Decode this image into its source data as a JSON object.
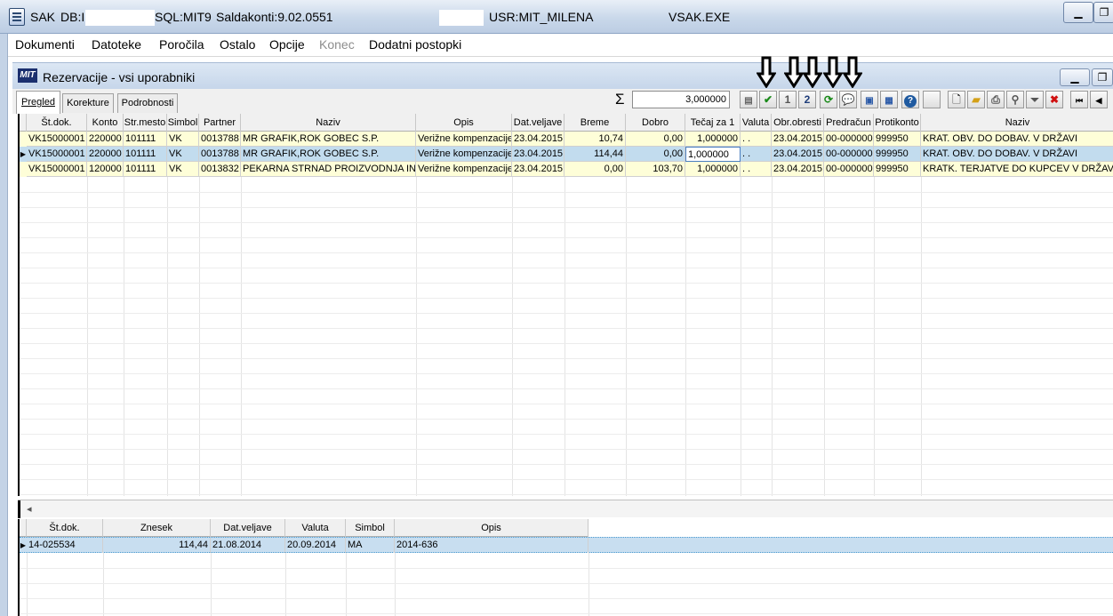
{
  "titlebar": {
    "app": "SAK",
    "db_label": "DB:I",
    "sql": "SQL:MIT9",
    "saldakonti": "Saldakonti:9.02.0551",
    "user": "USR:MIT_MILENA",
    "exe": "VSAK.EXE"
  },
  "menu": [
    "Dokumenti",
    "Datoteke",
    "Poročila",
    "Ostalo",
    "Opcije",
    "Konec",
    "Dodatni postopki"
  ],
  "window": {
    "logo": "MIT",
    "title": "Rezervacije - vsi uporabniki"
  },
  "tabs": [
    "Pregled",
    "Korekture",
    "Podrobnosti"
  ],
  "sum": {
    "symbol": "Σ",
    "value": "3,000000"
  },
  "toolbar_labels": {
    "btn1": "1",
    "btn2": "2"
  },
  "grid": {
    "columns": [
      "Št.dok.",
      "Konto",
      "Str.mesto",
      "Simbol",
      "Partner",
      "Naziv",
      "Opis",
      "Dat.veljave",
      "Breme",
      "Dobro",
      "Tečaj za 1",
      "Valuta",
      "Obr.obresti",
      "Predračun",
      "Protikonto",
      "Naziv"
    ],
    "rows": [
      [
        "VK15000001",
        "220000",
        "101111",
        "VK",
        "0013788",
        "MR GRAFIK,ROK GOBEC S.P.",
        "Verižne kompenzacije",
        "23.04.2015",
        "10,74",
        "0,00",
        "1,000000",
        ". .",
        "23.04.2015",
        "00-000000",
        "999950",
        "KRAT. OBV. DO DOBAV. V DRŽAVI"
      ],
      [
        "VK15000001",
        "220000",
        "101111",
        "VK",
        "0013788",
        "MR GRAFIK,ROK GOBEC S.P.",
        "Verižne kompenzacije",
        "23.04.2015",
        "114,44",
        "0,00",
        "1,000000",
        ". .",
        "23.04.2015",
        "00-000000",
        "999950",
        "KRAT. OBV. DO DOBAV. V DRŽAVI"
      ],
      [
        "VK15000001",
        "120000",
        "101111",
        "VK",
        "0013832",
        "PEKARNA STRNAD PROIZVODNJA IN",
        "Verižne kompenzacije",
        "23.04.2015",
        "0,00",
        "103,70",
        "1,000000",
        ". .",
        "23.04.2015",
        "00-000000",
        "999950",
        "KRATK. TERJATVE DO KUPCEV V DRŽAVI"
      ]
    ]
  },
  "scroll_arrow": "◂",
  "grid2": {
    "columns": [
      "Št.dok.",
      "Znesek",
      "Dat.veljave",
      "Valuta",
      "Simbol",
      "Opis"
    ],
    "rows": [
      [
        "14-025534",
        "114,44",
        "21.08.2014",
        "20.09.2014",
        "MA",
        "2014-636"
      ]
    ]
  }
}
